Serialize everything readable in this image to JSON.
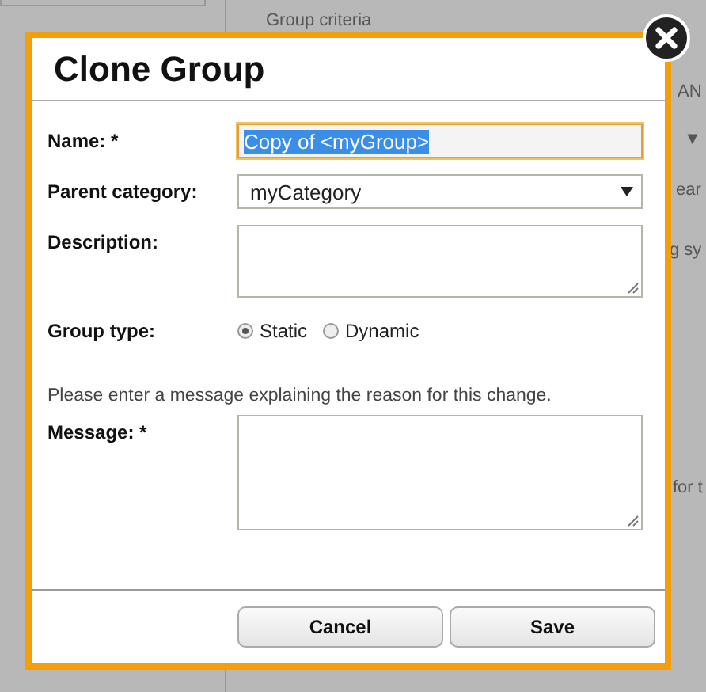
{
  "background": {
    "legend": "Group criteria",
    "fragments": [
      "AN",
      "▼",
      "ear",
      "g sy",
      "for t"
    ]
  },
  "dialog": {
    "title": "Clone Group",
    "fields": [
      {
        "kind": "text",
        "label": "Name: *",
        "value": "Copy of <myGroup>",
        "focused": true
      },
      {
        "kind": "select",
        "label": "Parent category:",
        "value": "myCategory"
      },
      {
        "kind": "textarea",
        "label": "Description:"
      },
      {
        "kind": "radio",
        "label": "Group type:",
        "options": [
          {
            "label": "Static",
            "selected": true
          },
          {
            "label": "Dynamic",
            "selected": false
          }
        ]
      },
      {
        "kind": "note",
        "text": "Please enter a message explaining the reason for this change."
      },
      {
        "kind": "textarea",
        "label": "Message: *"
      }
    ],
    "buttons": [
      "Cancel",
      "Save"
    ]
  }
}
